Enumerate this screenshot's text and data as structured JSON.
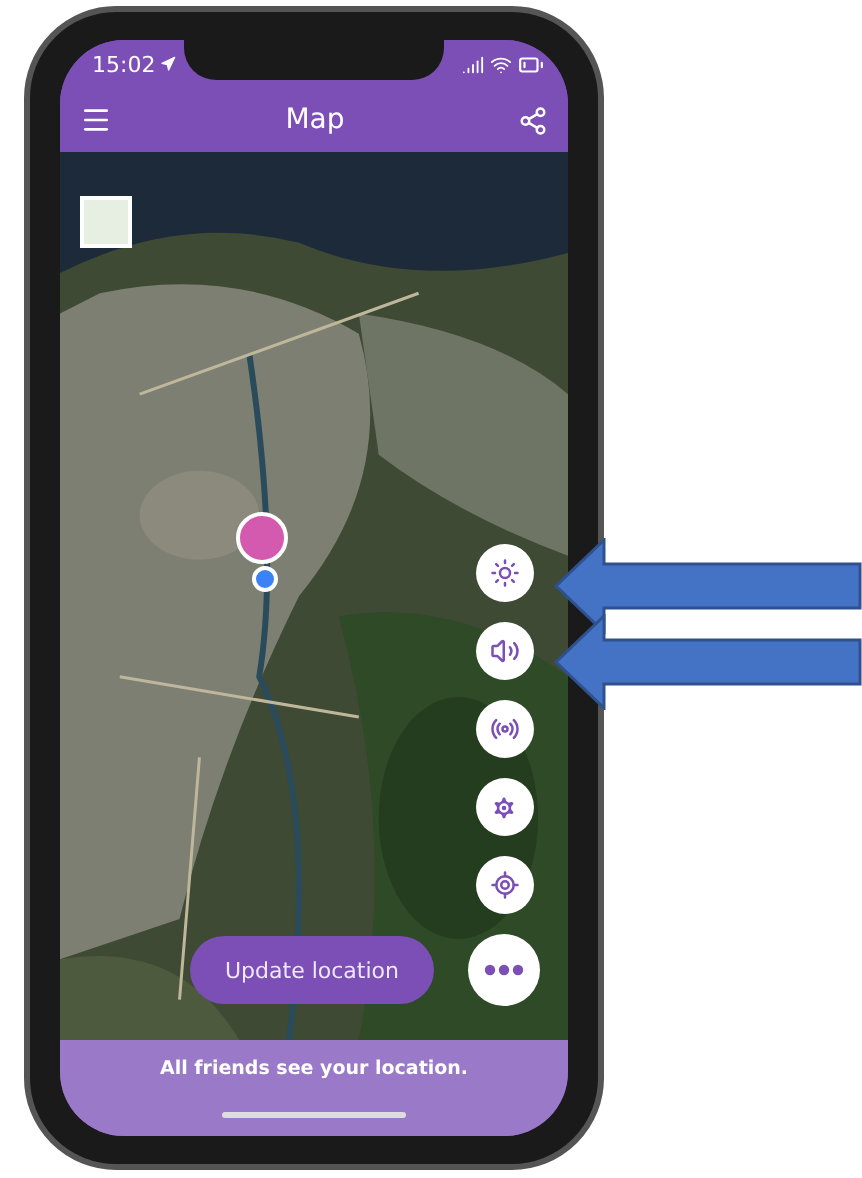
{
  "status_bar": {
    "time": "15:02"
  },
  "header": {
    "title": "Map"
  },
  "map_buttons": [
    {
      "kind": "brightness"
    },
    {
      "kind": "volume"
    },
    {
      "kind": "broadcast"
    },
    {
      "kind": "settings"
    },
    {
      "kind": "locate"
    },
    {
      "kind": "more"
    }
  ],
  "update_button": {
    "label": "Update location"
  },
  "footer": {
    "text": "All friends see your location."
  },
  "annotations": [
    {
      "kind": "arrow"
    },
    {
      "kind": "arrow"
    }
  ]
}
